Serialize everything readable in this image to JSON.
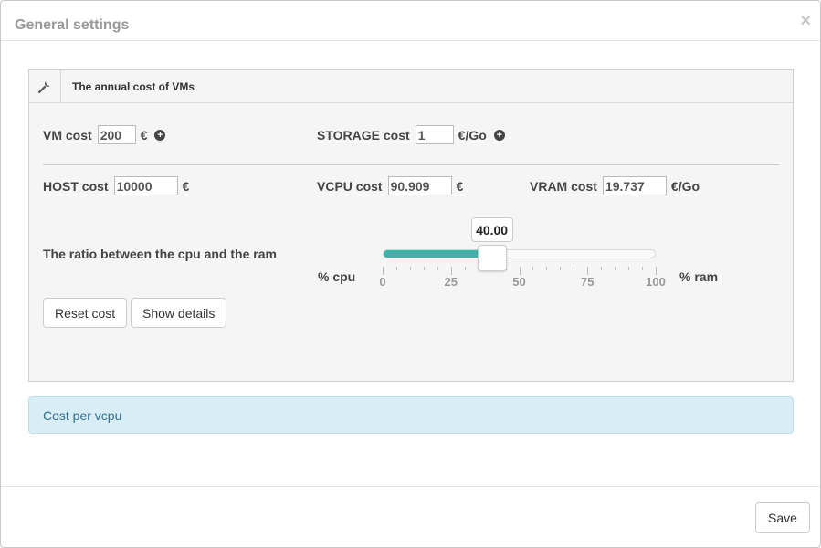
{
  "modal": {
    "title": "General settings",
    "close_symbol": "×"
  },
  "panel": {
    "icon": "wrench-icon",
    "title": "The annual cost of VMs",
    "vm_cost": {
      "label": "VM cost",
      "value": "200",
      "unit": "€"
    },
    "storage_cost": {
      "label": "STORAGE cost",
      "value": "1",
      "unit": "€/Go"
    },
    "host_cost": {
      "label": "HOST cost",
      "value": "10000",
      "unit": "€"
    },
    "vcpu_cost": {
      "label": "VCPU cost",
      "value": "90.909",
      "unit": "€"
    },
    "vram_cost": {
      "label": "VRAM cost",
      "value": "19.737",
      "unit": "€/Go"
    },
    "ratio": {
      "label": "The ratio between the cpu and the ram",
      "left_label": "% cpu",
      "right_label": "% ram",
      "value_text": "40.00",
      "value": 40,
      "min": 0,
      "max": 100,
      "tick_labels": [
        "0",
        "25",
        "50",
        "75",
        "100"
      ],
      "fill_color": "#3fb2a9"
    },
    "buttons": {
      "reset": "Reset cost",
      "details": "Show details"
    }
  },
  "alert": {
    "text": "Cost per vcpu"
  },
  "footer": {
    "save": "Save"
  }
}
